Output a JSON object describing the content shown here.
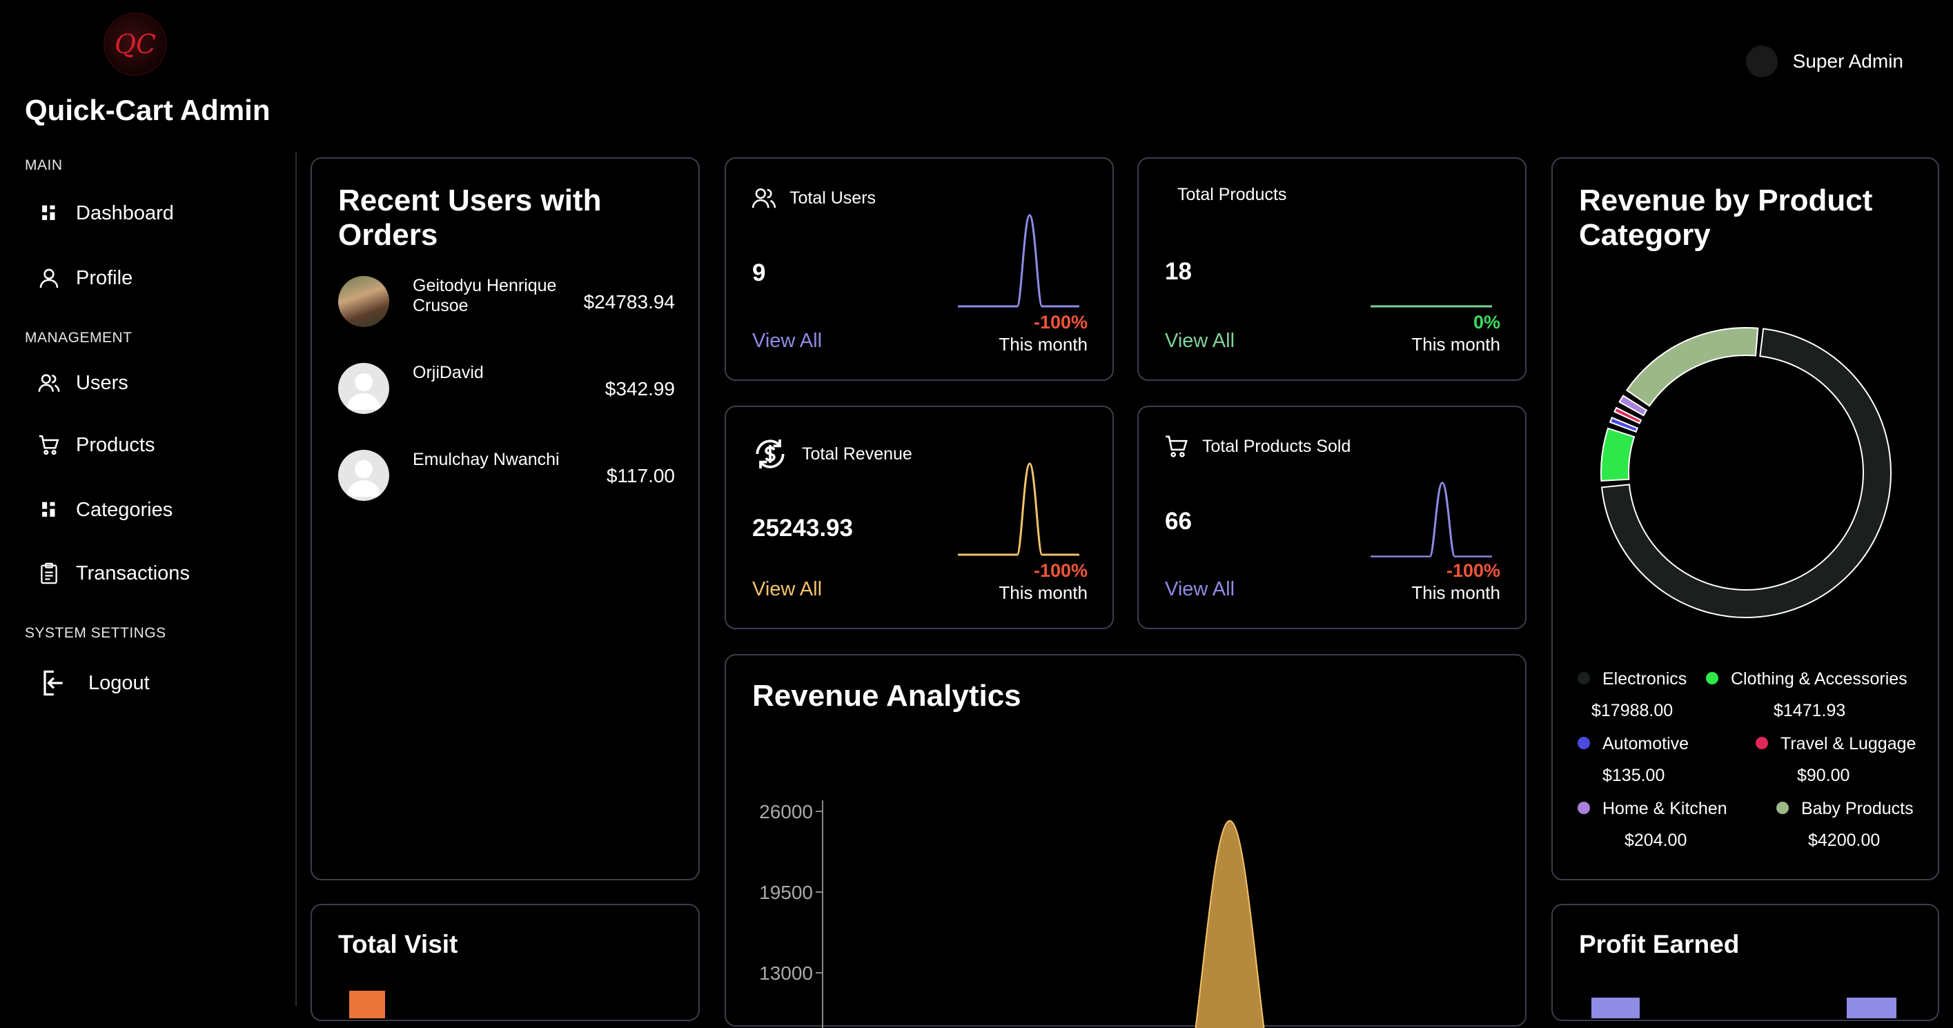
{
  "app": {
    "title": "Quick-Cart Admin",
    "logo_text": "QC"
  },
  "user": {
    "name": "Super Admin"
  },
  "sidebar": {
    "sections": [
      {
        "label": "MAIN",
        "items": [
          {
            "label": "Dashboard",
            "icon": "dashboard-icon"
          },
          {
            "label": "Profile",
            "icon": "user-icon"
          }
        ]
      },
      {
        "label": "MANAGEMENT",
        "items": [
          {
            "label": "Users",
            "icon": "users-icon"
          },
          {
            "label": "Products",
            "icon": "cart-icon"
          },
          {
            "label": "Categories",
            "icon": "grid-icon"
          },
          {
            "label": "Transactions",
            "icon": "clipboard-icon"
          }
        ]
      },
      {
        "label": "SYSTEM SETTINGS",
        "items": [
          {
            "label": "Logout",
            "icon": "logout-icon"
          }
        ]
      }
    ]
  },
  "recent_users": {
    "title": "Recent Users with Orders",
    "rows": [
      {
        "name": "Geitodyu Henrique Crusoe",
        "amount": "$24783.94",
        "has_photo": true
      },
      {
        "name": "OrjiDavid",
        "amount": "$342.99",
        "has_photo": false
      },
      {
        "name": "Emulchay Nwanchi",
        "amount": "$117.00",
        "has_photo": false
      }
    ]
  },
  "stats": {
    "total_users": {
      "title": "Total Users",
      "value": "9",
      "link": "View All",
      "change": "-100%",
      "period": "This month",
      "color": "#8f8ce6",
      "change_color": "#f0553a"
    },
    "total_products": {
      "title": "Total Products",
      "value": "18",
      "link": "View All",
      "change": "0%",
      "period": "This month",
      "color": "#7fd49a",
      "change_color": "#3ddc5c"
    },
    "total_revenue": {
      "title": "Total Revenue",
      "value": "25243.93",
      "link": "View All",
      "change": "-100%",
      "period": "This month",
      "color": "#f3c26b",
      "change_color": "#f0553a"
    },
    "total_products_sold": {
      "title": "Total Products Sold",
      "value": "66",
      "link": "View All",
      "change": "-100%",
      "period": "This month",
      "color": "#8f8ce6",
      "change_color": "#f0553a"
    }
  },
  "revenue_by_category": {
    "title": "Revenue by Product Category",
    "legend": [
      {
        "name": "Electronics",
        "value": "$17988.00",
        "color": "#1b1f1e"
      },
      {
        "name": "Clothing & Accessories",
        "value": "$1471.93",
        "color": "#2ee84a"
      },
      {
        "name": "Automotive",
        "value": "$135.00",
        "color": "#4b4be0"
      },
      {
        "name": "Travel & Luggage",
        "value": "$90.00",
        "color": "#e0285a"
      },
      {
        "name": "Home & Kitchen",
        "value": "$204.00",
        "color": "#a882dc"
      },
      {
        "name": "Baby Products",
        "value": "$4200.00",
        "color": "#9db888"
      }
    ]
  },
  "revenue_analytics": {
    "title": "Revenue Analytics"
  },
  "total_visit": {
    "title": "Total Visit"
  },
  "profit_earned": {
    "title": "Profit Earned"
  },
  "chart_data": [
    {
      "type": "pie",
      "title": "Revenue by Product Category",
      "categories": [
        "Electronics",
        "Clothing & Accessories",
        "Automotive",
        "Travel & Luggage",
        "Home & Kitchen",
        "Baby Products"
      ],
      "values": [
        17988.0,
        1471.93,
        135.0,
        90.0,
        204.0,
        4200.0
      ],
      "donut": true
    },
    {
      "type": "area",
      "title": "Revenue Analytics",
      "y_ticks": [
        26000,
        19500,
        13000
      ],
      "peak": 25243.93,
      "color": "#b58a3e"
    }
  ]
}
